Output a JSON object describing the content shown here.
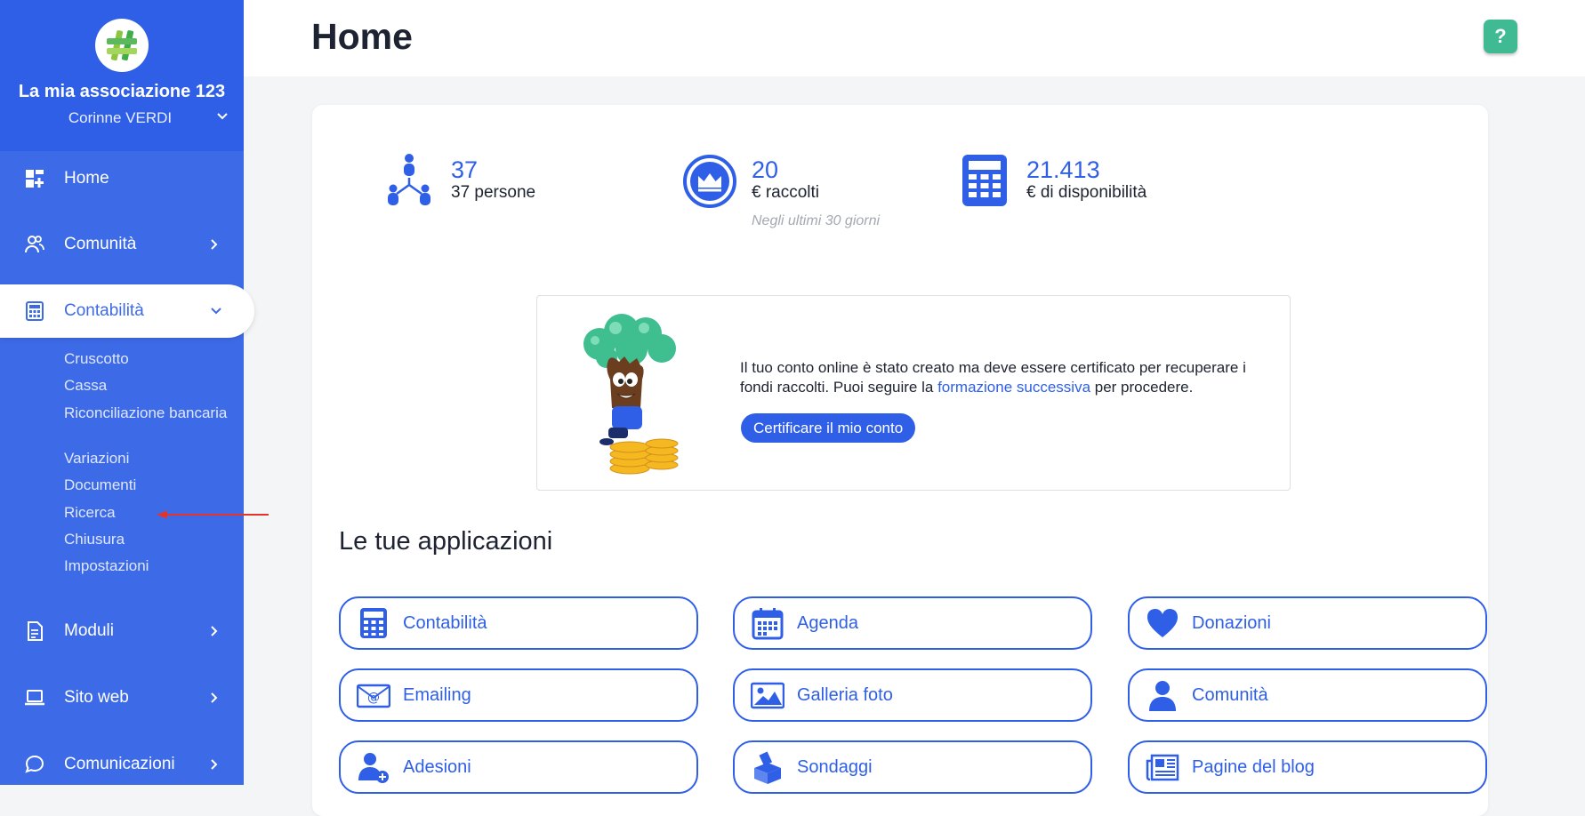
{
  "sidebar": {
    "org_name": "La mia associazione 123",
    "user_name": "Corinne VERDI",
    "nav": {
      "home": "Home",
      "comunita": "Comunità",
      "contabilita": "Contabilità",
      "moduli": "Moduli",
      "sito_web": "Sito web",
      "comunicazioni": "Comunicazioni"
    },
    "sub_items": [
      "Cruscotto",
      "Cassa",
      "Riconciliazione bancaria",
      "Variazioni",
      "Documenti",
      "Ricerca",
      "Chiusura",
      "Impostazioni"
    ]
  },
  "header": {
    "title": "Home",
    "help_label": "?"
  },
  "stats": [
    {
      "value": "37",
      "label": "37 persone",
      "icon": "people-network-icon"
    },
    {
      "value": "20",
      "label": "€ raccolti",
      "note": "Negli ultimi 30 giorni",
      "icon": "crown-badge-icon"
    },
    {
      "value": "21.413",
      "label": "€ di disponibilità",
      "icon": "calculator-icon"
    }
  ],
  "promo": {
    "text_before": "Il tuo conto online è stato creato ma deve essere certificato per recuperare i fondi raccolti. Puoi seguire la ",
    "link": "formazione successiva",
    "text_after": " per procedere.",
    "button": "Certificare il mio conto"
  },
  "apps": {
    "title": "Le tue applicazioni",
    "items": [
      {
        "label": "Contabilità",
        "icon": "calculator-icon"
      },
      {
        "label": "Agenda",
        "icon": "calendar-icon"
      },
      {
        "label": "Donazioni",
        "icon": "heart-icon"
      },
      {
        "label": "Emailing",
        "icon": "email-icon"
      },
      {
        "label": "Galleria foto",
        "icon": "image-icon"
      },
      {
        "label": "Comunità",
        "icon": "person-icon"
      },
      {
        "label": "Adesioni",
        "icon": "add-person-icon"
      },
      {
        "label": "Sondaggi",
        "icon": "ballot-box-icon"
      },
      {
        "label": "Pagine del blog",
        "icon": "newspaper-icon"
      }
    ]
  },
  "colors": {
    "sidebar": "#3d6be8",
    "accent": "#2f5fe6",
    "help": "#3fba93",
    "arrow": "#e5332a"
  }
}
